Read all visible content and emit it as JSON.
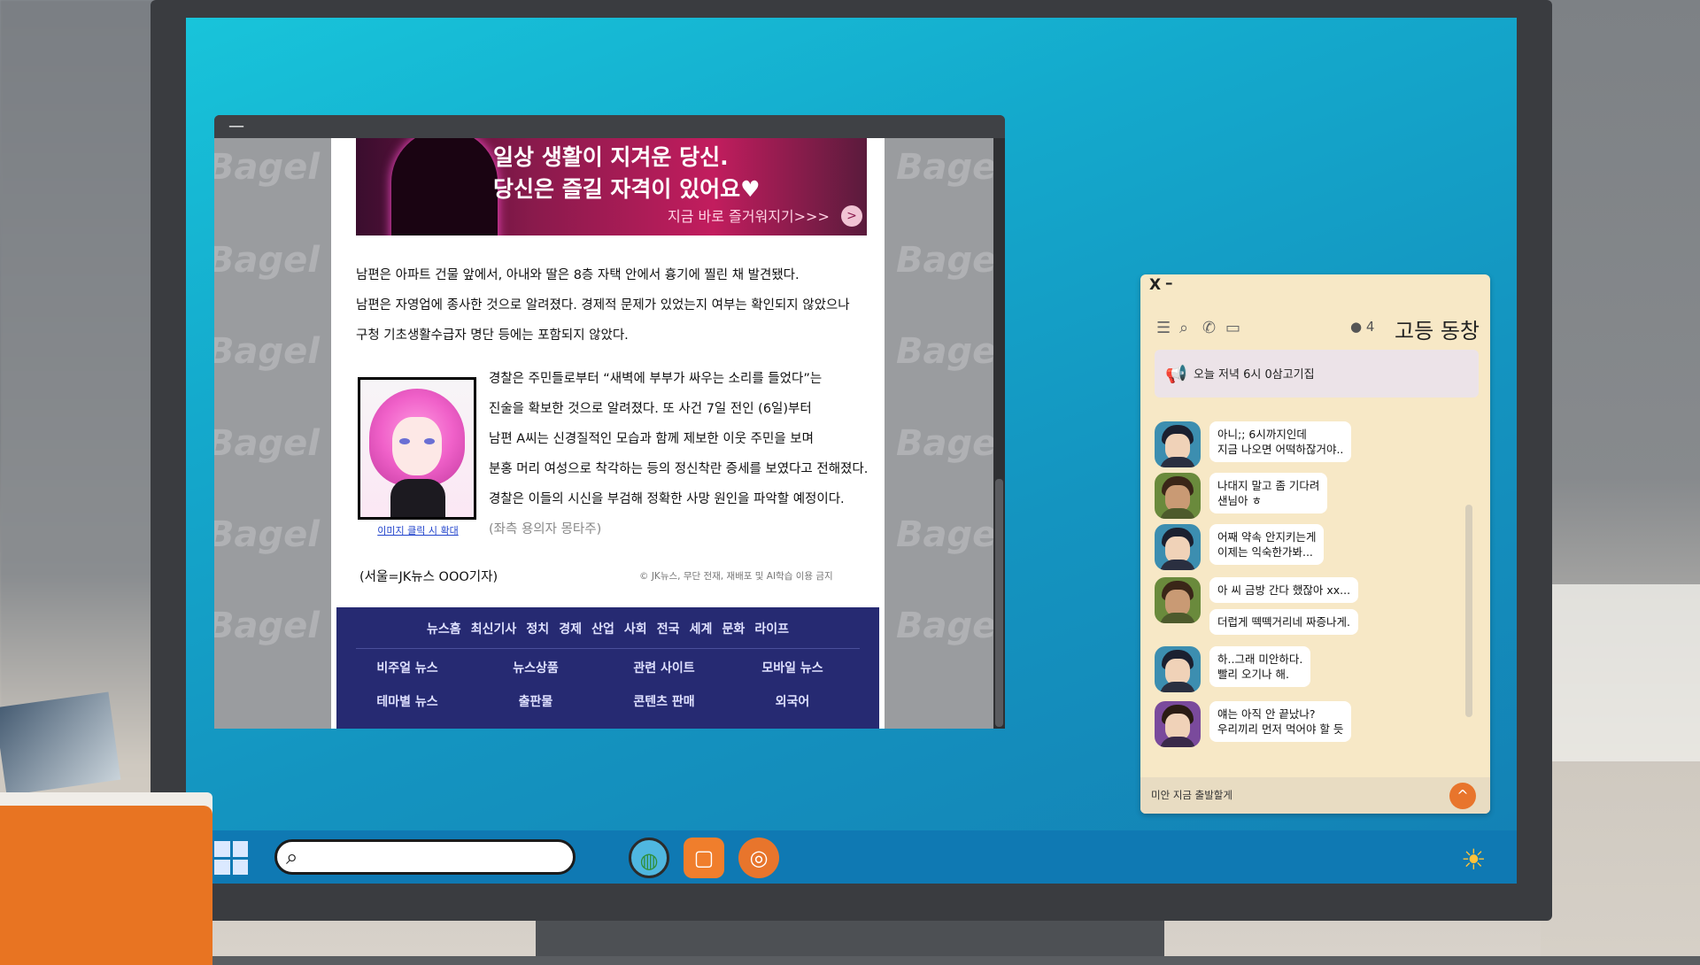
{
  "browser": {
    "minimize": "—",
    "watermark": "Bagel Ne",
    "ad": {
      "line1": "일상 생활이 지겨운 당신.",
      "line2": "당신은 즐길 자격이 있어요♥",
      "cta": "지금 바로 즐거워지기>>>",
      "arrow": ">"
    },
    "article": {
      "p1": "남편은 아파트 건물 앞에서, 아내와 딸은 8층 자택 안에서 흉기에 찔린 채 발견됐다.",
      "p2": "남편은 자영업에 종사한 것으로 알려졌다. 경제적 문제가 있었는지 여부는 확인되지 않았으나",
      "p3": "구청 기초생활수급자 명단 등에는 포함되지 않았다.",
      "p4": "경찰은 주민들로부터 “새벽에 부부가 싸우는 소리를 들었다”는",
      "p5": "진술을 확보한 것으로 알려졌다. 또 사건 7일 전인 (6일)부터",
      "p6": "남편 A씨는 신경질적인 모습과 함께 제보한 이웃 주민을 보며",
      "p7": "분홍 머리 여성으로 착각하는 등의 정신착란 증세를 보였다고 전해졌다.",
      "p8": "경찰은 이들의 시신을 부검해 정확한 사망 원인을 파악할 예정이다.",
      "caption": "(좌측 용의자 몽타주)",
      "image_link": "이미지 클릭 시 확대",
      "byline": "(서울=JK뉴스 OOO기자)",
      "copyright": "© JK뉴스, 무단 전재, 재배포 및 AI학습 이용 금지"
    },
    "footer": {
      "top_links": [
        "뉴스홈",
        "최신기사",
        "정치",
        "경제",
        "산업",
        "사회",
        "전국",
        "세계",
        "문화",
        "라이프"
      ],
      "grid": [
        [
          "비주얼 뉴스",
          "뉴스상품",
          "관련 사이트",
          "모바일 뉴스"
        ],
        [
          "테마별 뉴스",
          "출판물",
          "콘텐츠 판매",
          "외국어"
        ]
      ]
    }
  },
  "chat": {
    "close": "X",
    "minimize": "–",
    "member_count": "4",
    "title": "고등 동창",
    "notice": "오늘 저녁 6시 0삼고기집",
    "messages": [
      {
        "text": "아니;; 6시까지인데\n지금 나오면 어떡하잖거야..",
        "avatar": "dark-hair"
      },
      {
        "text": "나대지 말고 좀 기다려\n샌님아 ㅎ",
        "avatar": "green"
      },
      {
        "text": "어째 약속 안지키는게\n이제는 익숙한가봐...",
        "avatar": "dark-hair"
      },
      {
        "text": "아 씨 금방 간다 했잖아 xx...",
        "avatar": "green"
      },
      {
        "text": "더럽게 떽떽거리네 짜증나게.",
        "avatar": "none"
      },
      {
        "text": "하..그래 미안하다.\n빨리 오기나 해.",
        "avatar": "dark-hair"
      },
      {
        "text": "얘는 아직 안 끝났나?\n우리끼리 먼저 먹어야 할 듯",
        "avatar": "purple"
      }
    ],
    "input_value": "미안 지금 출발할게",
    "send_icon": "^"
  },
  "taskbar": {
    "search_placeholder": "",
    "apps": [
      "globe-icon",
      "chat-icon",
      "magnifier-app-icon"
    ]
  },
  "colors": {
    "desktop": "#1494c0",
    "taskbar": "#0f79b3",
    "footer_nav": "#262a72",
    "chat_bg": "#f7e8c6",
    "accent": "#e8752c"
  }
}
